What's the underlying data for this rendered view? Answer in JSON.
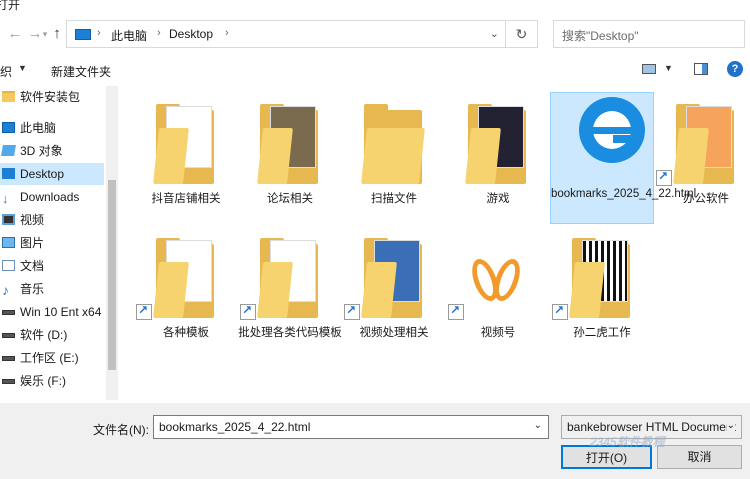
{
  "window": {
    "title": "打开"
  },
  "address": {
    "crumbs": [
      "此电脑",
      "Desktop"
    ],
    "search_placeholder": "搜索\"Desktop\""
  },
  "toolbar": {
    "organize": "织",
    "new_folder": "新建文件夹"
  },
  "nav": {
    "items": [
      {
        "label": "软件安装包",
        "icon": "folder-icon"
      },
      {
        "label": "此电脑",
        "icon": "computer-icon"
      },
      {
        "label": "3D 对象",
        "icon": "3d-objects-icon"
      },
      {
        "label": "Desktop",
        "icon": "desktop-icon",
        "selected": true
      },
      {
        "label": "Downloads",
        "icon": "download-icon"
      },
      {
        "label": "视频",
        "icon": "video-icon"
      },
      {
        "label": "图片",
        "icon": "pictures-icon"
      },
      {
        "label": "文档",
        "icon": "documents-icon"
      },
      {
        "label": "音乐",
        "icon": "music-icon"
      },
      {
        "label": "Win 10 Ent x64",
        "icon": "drive-icon"
      },
      {
        "label": "软件 (D:)",
        "icon": "drive-icon"
      },
      {
        "label": "工作区 (E:)",
        "icon": "drive-icon"
      },
      {
        "label": "娱乐 (F:)",
        "icon": "drive-icon"
      }
    ]
  },
  "files": [
    {
      "name": "抖音店铺相关",
      "kind": "folder"
    },
    {
      "name": "论坛相关",
      "kind": "folder"
    },
    {
      "name": "扫描文件",
      "kind": "folder"
    },
    {
      "name": "游戏",
      "kind": "folder"
    },
    {
      "name": "bookmarks_2025_4_22.html",
      "kind": "html",
      "selected": true
    },
    {
      "name": "办公软件",
      "kind": "folder-shortcut"
    },
    {
      "name": "各种模板",
      "kind": "folder-shortcut"
    },
    {
      "name": "批处理各类代码模板",
      "kind": "folder-shortcut"
    },
    {
      "name": "视频处理相关",
      "kind": "folder-shortcut"
    },
    {
      "name": "视频号",
      "kind": "app-shortcut"
    },
    {
      "name": "孙二虎工作",
      "kind": "folder-shortcut"
    }
  ],
  "footer": {
    "filename_label": "文件名(N):",
    "filename_value": "bookmarks_2025_4_22.html",
    "filetype_value": "bankebrowser HTML Document",
    "open_label": "打开(O)",
    "cancel_label": "取消",
    "watermark": "2345软件教程"
  }
}
